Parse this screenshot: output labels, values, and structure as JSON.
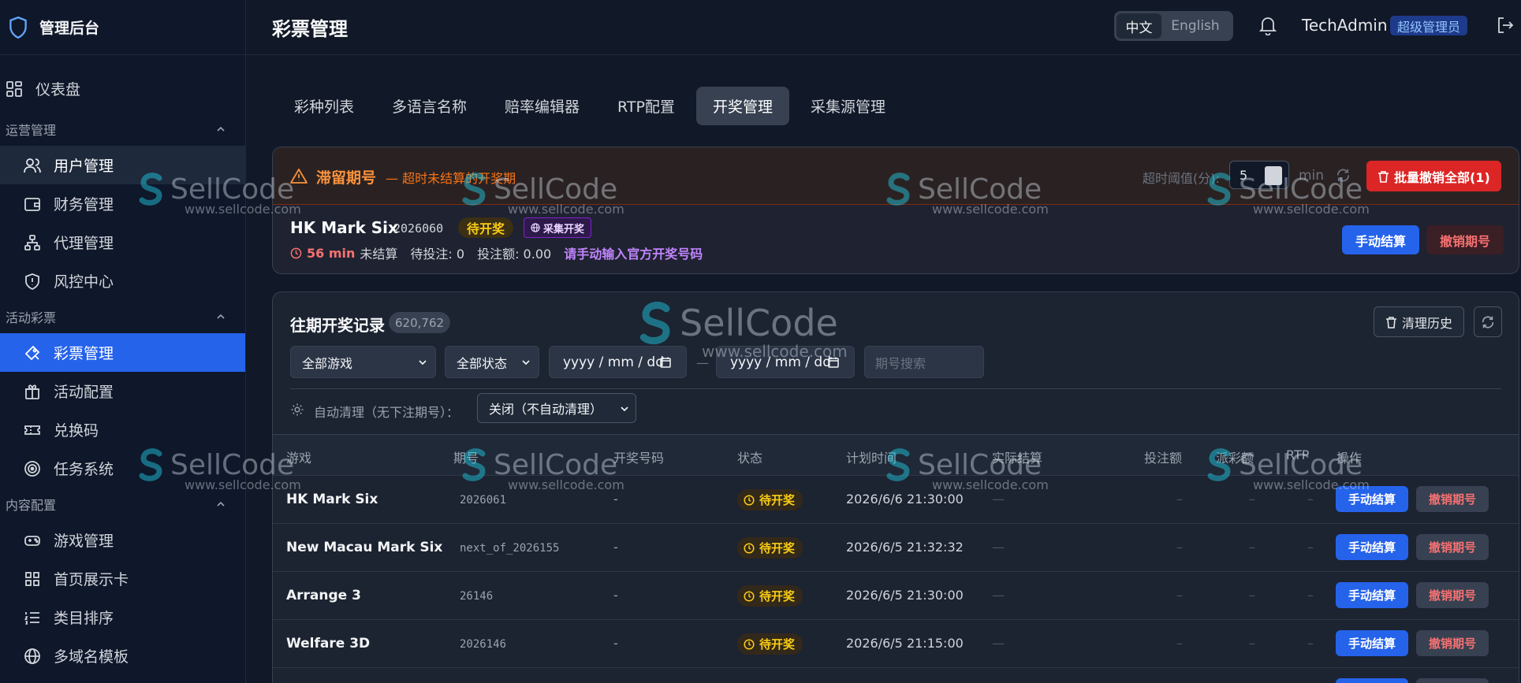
{
  "brand": {
    "title": "管理后台"
  },
  "sidebar": {
    "top_item": {
      "label": "仪表盘"
    },
    "groups": [
      {
        "title": "运营管理",
        "items": [
          {
            "label": "用户管理"
          },
          {
            "label": "财务管理"
          },
          {
            "label": "代理管理"
          },
          {
            "label": "风控中心"
          }
        ]
      },
      {
        "title": "活动彩票",
        "items": [
          {
            "label": "彩票管理"
          },
          {
            "label": "活动配置"
          },
          {
            "label": "兑换码"
          },
          {
            "label": "任务系统"
          }
        ]
      },
      {
        "title": "内容配置",
        "items": [
          {
            "label": "游戏管理"
          },
          {
            "label": "首页展示卡"
          },
          {
            "label": "类目排序"
          },
          {
            "label": "多域名模板"
          }
        ]
      }
    ]
  },
  "header": {
    "title": "彩票管理",
    "lang_zh": "中文",
    "lang_en": "English",
    "username": "TechAdmin",
    "role": "超级管理员"
  },
  "tabs": [
    "彩种列表",
    "多语言名称",
    "赔率编辑器",
    "RTP配置",
    "开奖管理",
    "采集源管理"
  ],
  "stale": {
    "title": "滞留期号",
    "subtitle": "— 超时未结算的开奖期",
    "threshold_label": "超时阈值(分):",
    "threshold_value": "5",
    "threshold_unit": "min",
    "bulk_revoke": "批量撤销全部(1)",
    "item": {
      "game": "HK Mark Six",
      "issue": "2026060",
      "status": "待开奖",
      "source_tag": "采集开奖",
      "elapsed": "56 min",
      "unsettled": "未结算",
      "pending_bets": "待投注: 0",
      "bet_amount": "投注额: 0.00",
      "hint": "请手动输入官方开奖号码",
      "settle": "手动结算",
      "revoke": "撤销期号"
    }
  },
  "history": {
    "title": "往期开奖记录",
    "count": "620,762",
    "clear_history": "清理历史",
    "filter_game": "全部游戏",
    "filter_status": "全部状态",
    "date_placeholder": "yyyy / mm / dd",
    "date_sep": "—",
    "search_placeholder": "期号搜索",
    "auto_clean_label": "自动清理（无下注期号）：",
    "auto_clean_value": "关闭（不自动清理）",
    "columns": [
      "游戏",
      "期号",
      "开奖号码",
      "状态",
      "计划时间",
      "实际结算",
      "投注额",
      "派彩额",
      "RTP",
      "操作"
    ],
    "rows": [
      {
        "game": "HK Mark Six",
        "issue": "2026061",
        "code": "-",
        "status": "待开奖",
        "time": "2026/6/6 21:30:00",
        "actual": "—",
        "bet": "–",
        "pay": "–",
        "rtp": "–",
        "settle": "手动结算",
        "revoke": "撤销期号"
      },
      {
        "game": "New Macau Mark Six",
        "issue": "next_of_2026155",
        "code": "-",
        "status": "待开奖",
        "time": "2026/6/5 21:32:32",
        "actual": "—",
        "bet": "–",
        "pay": "–",
        "rtp": "–",
        "settle": "手动结算",
        "revoke": "撤销期号"
      },
      {
        "game": "Arrange 3",
        "issue": "26146",
        "code": "-",
        "status": "待开奖",
        "time": "2026/6/5 21:30:00",
        "actual": "—",
        "bet": "–",
        "pay": "–",
        "rtp": "–",
        "settle": "手动结算",
        "revoke": "撤销期号"
      },
      {
        "game": "Welfare 3D",
        "issue": "2026146",
        "code": "-",
        "status": "待开奖",
        "time": "2026/6/5 21:15:00",
        "actual": "—",
        "bet": "–",
        "pay": "–",
        "rtp": "–",
        "settle": "手动结算",
        "revoke": "撤销期号"
      }
    ]
  },
  "watermark": {
    "name": "SellCode",
    "url": "www.sellcode.com"
  },
  "colors": {
    "accent": "#2563eb",
    "danger": "#dc2626",
    "pending": "#facc15",
    "warning": "#fb923c"
  }
}
